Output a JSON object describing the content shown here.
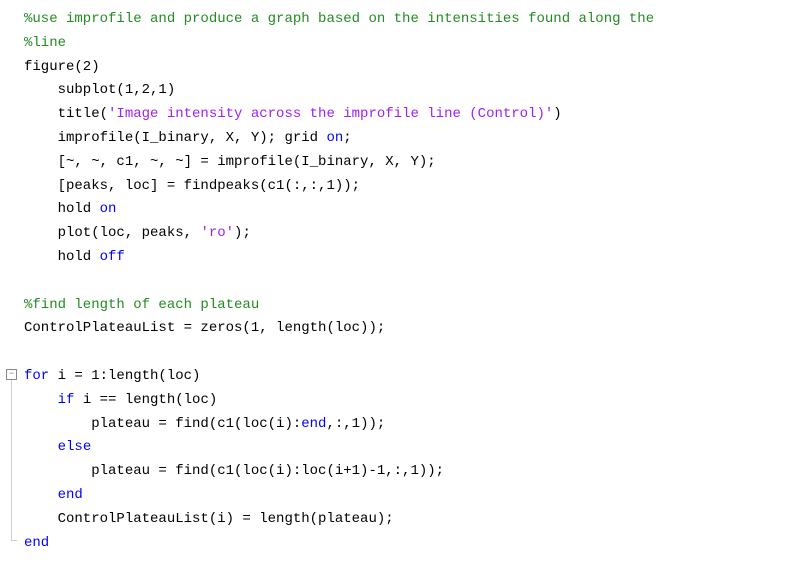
{
  "code": {
    "l1": "%use improfile and produce a graph based on the intensities found along the",
    "l2": "%line",
    "l3_pre": "figure(2)",
    "l4_pre": "    subplot(1,2,1)",
    "l5_pre": "    title(",
    "l5_str": "'Image intensity across the improfile line (Control)'",
    "l5_post": ")",
    "l6_pre": "    improfile(I_binary, X, Y); grid ",
    "l6_kw": "on",
    "l6_post": ";",
    "l7": "    [~, ~, c1, ~, ~] = improfile(I_binary, X, Y);",
    "l8": "    [peaks, loc] = findpeaks(c1(:,:,1));",
    "l9_pre": "    hold ",
    "l9_kw": "on",
    "l10_pre": "    plot(loc, peaks, ",
    "l10_str": "'ro'",
    "l10_post": ");",
    "l11_pre": "    hold ",
    "l11_kw": "off",
    "l12": " ",
    "l13": "%find length of each plateau",
    "l14": "ControlPlateauList = zeros(1, length(loc));",
    "l15": " ",
    "l16_kw": "for",
    "l16_post": " i = 1:length(loc)",
    "l17_pre": "    ",
    "l17_kw": "if",
    "l17_post": " i == length(loc)",
    "l18_pre": "        plateau = find(c1(loc(i):",
    "l18_kw": "end",
    "l18_post": ",:,1));",
    "l19_pre": "    ",
    "l19_kw": "else",
    "l20": "        plateau = find(c1(loc(i):loc(i+1)-1,:,1));",
    "l21_pre": "    ",
    "l21_kw": "end",
    "l22": "    ControlPlateauList(i) = length(plateau);",
    "l23_kw": "end"
  },
  "fold": {
    "minus": "−"
  }
}
